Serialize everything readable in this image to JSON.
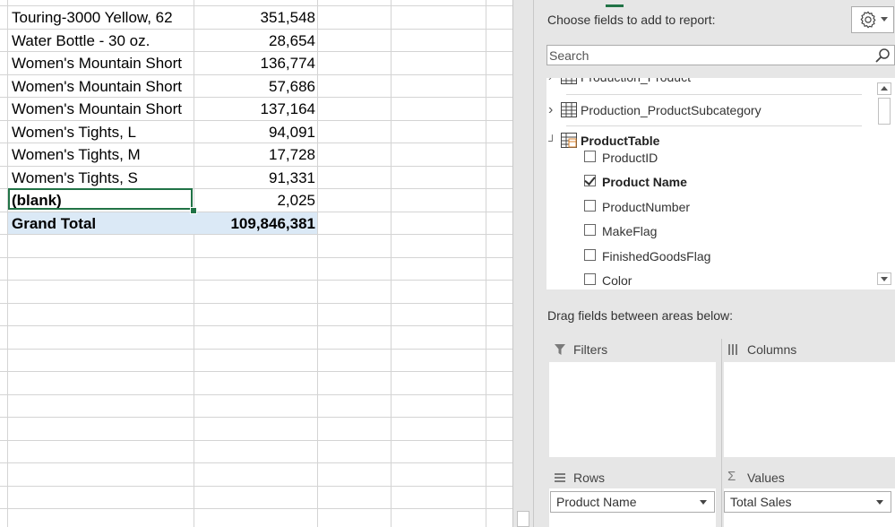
{
  "sheet": {
    "rows": [
      {
        "label": "Touring-3000 Yellow, 62",
        "value": "351,548"
      },
      {
        "label": "Water Bottle - 30 oz.",
        "value": "28,654"
      },
      {
        "label": "Women's Mountain Short",
        "value": "136,774"
      },
      {
        "label": "Women's Mountain Short",
        "value": "57,686"
      },
      {
        "label": "Women's Mountain Short",
        "value": "137,164"
      },
      {
        "label": "Women's Tights, L",
        "value": "94,091"
      },
      {
        "label": "Women's Tights, M",
        "value": "17,728"
      },
      {
        "label": "Women's Tights, S",
        "value": "91,331"
      },
      {
        "label": "(blank)",
        "value": "2,025"
      }
    ],
    "grand_total": {
      "label": "Grand Total",
      "value": "109,846,381"
    }
  },
  "pane": {
    "title": "Choose fields to add to report:",
    "settings_icon": "gear-icon",
    "search": {
      "placeholder": "Search",
      "icon": "search-icon"
    },
    "field_list": {
      "tables": [
        {
          "name": "Production_Product",
          "expanded": false,
          "partially_visible": true
        },
        {
          "name": "Production_ProductSubcategory",
          "expanded": false
        },
        {
          "name": "ProductTable",
          "expanded": true
        }
      ],
      "fields": [
        {
          "name": "ProductID",
          "checked": false
        },
        {
          "name": "Product Name",
          "checked": true
        },
        {
          "name": "ProductNumber",
          "checked": false
        },
        {
          "name": "MakeFlag",
          "checked": false
        },
        {
          "name": "FinishedGoodsFlag",
          "checked": false
        },
        {
          "name": "Color",
          "checked": false
        }
      ]
    },
    "drag_label": "Drag fields between areas below:",
    "areas": {
      "filters": {
        "label": "Filters",
        "icon": "filter-icon"
      },
      "columns": {
        "label": "Columns",
        "icon": "columns-icon"
      },
      "rows": {
        "label": "Rows",
        "icon": "rows-icon",
        "item": "Product Name"
      },
      "values": {
        "label": "Values",
        "icon": "sigma-icon",
        "item": "Total Sales"
      }
    }
  },
  "colors": {
    "accent_green": "#217346",
    "grand_total_bg": "#dbe9f6",
    "pane_bg": "#e6e6e6"
  }
}
